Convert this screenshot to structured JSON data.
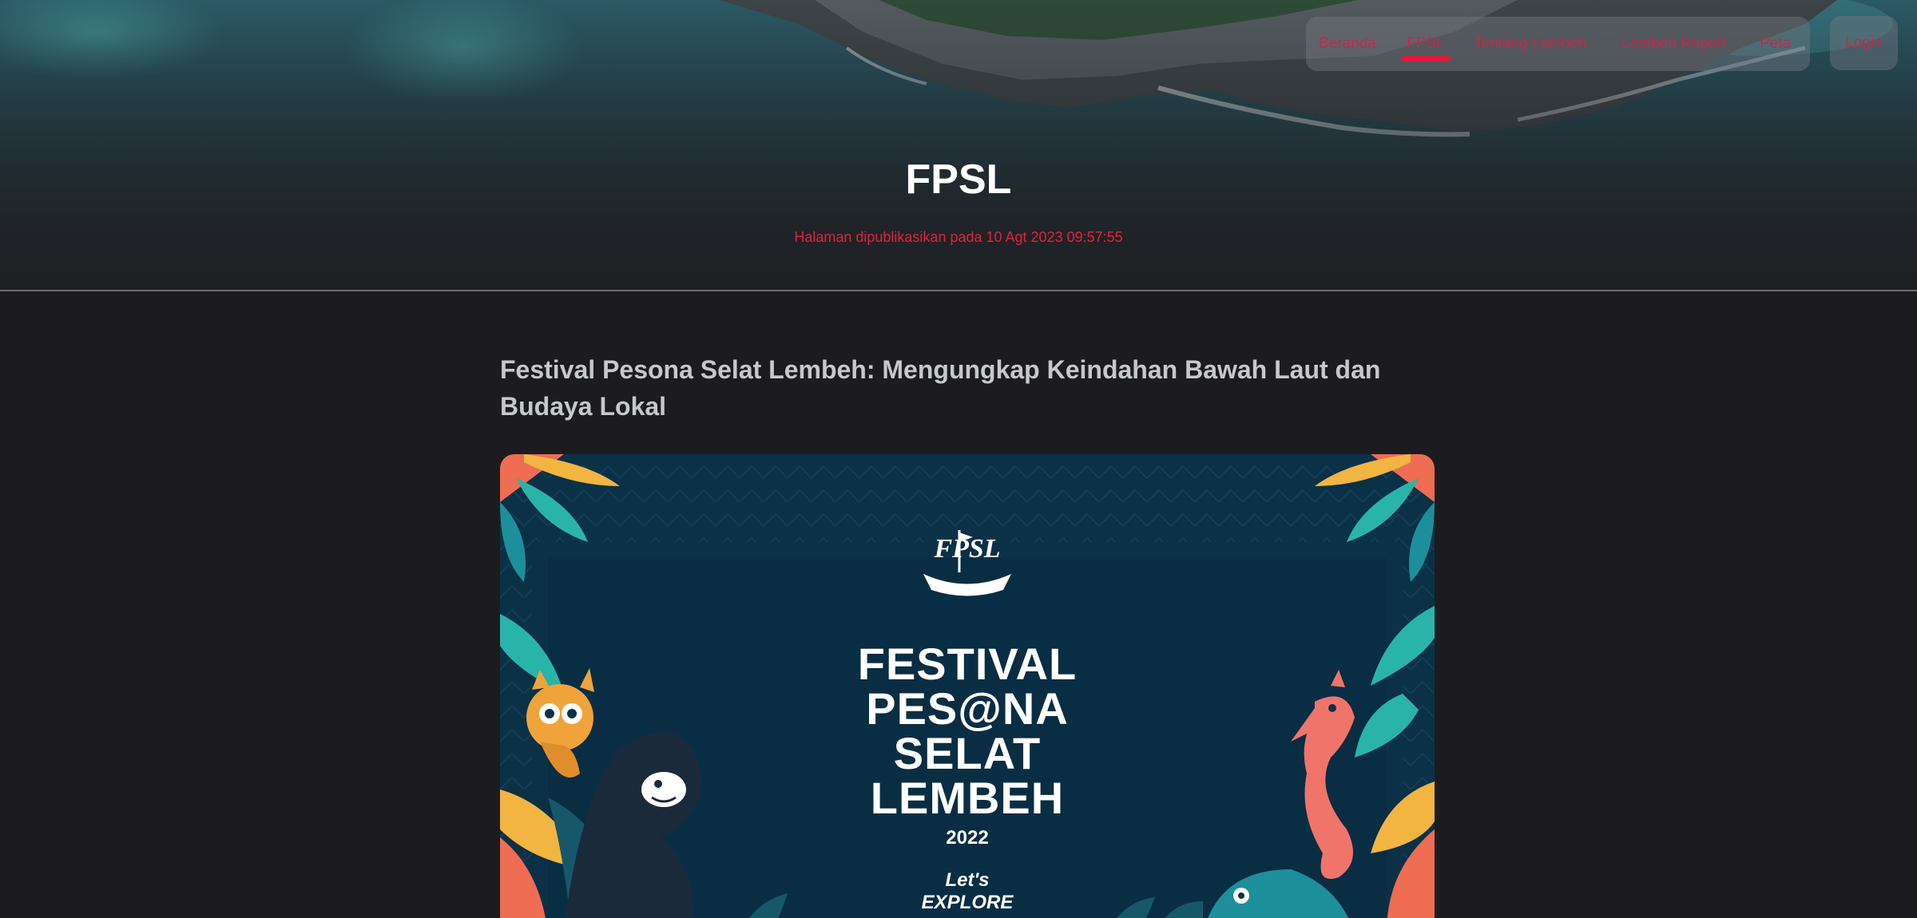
{
  "nav": {
    "items": [
      {
        "label": "Beranda"
      },
      {
        "label": "FPSL"
      },
      {
        "label": "Tentang Lembeh"
      },
      {
        "label": "Lembeh Report"
      },
      {
        "label": "Peta"
      }
    ],
    "active_index": 1,
    "login_label": "Login"
  },
  "hero": {
    "title": "FPSL",
    "subtitle": "Halaman dipublikasikan pada 10 Agt 2023 09:57:55"
  },
  "article": {
    "title": "Festival Pesona Selat Lembeh: Mengungkap Keindahan Bawah Laut dan Budaya Lokal",
    "poster": {
      "logo_text": "FPSL",
      "lines": [
        "FESTIVAL",
        "PES@NA",
        "SELAT",
        "LEMBEH"
      ],
      "year": "2022",
      "tagline": "Let's EXPLORE"
    }
  },
  "colors": {
    "accent": "#e0183e",
    "page_bg": "#1c1c1f",
    "poster_bg": "#0b3147"
  }
}
